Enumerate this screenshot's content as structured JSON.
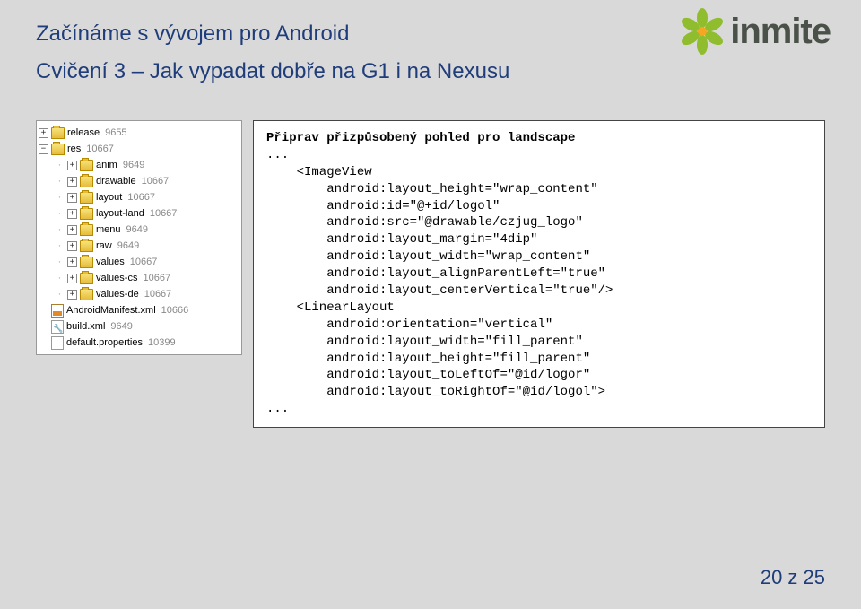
{
  "header": {
    "title": "Začínáme s vývojem pro Android",
    "subtitle": "Cvičení 3 – Jak vypadat dobře na G1 i na Nexusu"
  },
  "logo": {
    "name": "inmite"
  },
  "tree": {
    "items": [
      {
        "level": 0,
        "expander": "+",
        "icon": "folder",
        "label": "release",
        "rev": "9655"
      },
      {
        "level": 0,
        "expander": "-",
        "icon": "folder",
        "label": "res",
        "rev": "10667"
      },
      {
        "level": 1,
        "expander": "+",
        "icon": "folder",
        "label": "anim",
        "rev": "9649"
      },
      {
        "level": 1,
        "expander": "+",
        "icon": "folder",
        "label": "drawable",
        "rev": "10667"
      },
      {
        "level": 1,
        "expander": "+",
        "icon": "folder",
        "label": "layout",
        "rev": "10667"
      },
      {
        "level": 1,
        "expander": "+",
        "icon": "folder",
        "label": "layout-land",
        "rev": "10667"
      },
      {
        "level": 1,
        "expander": "+",
        "icon": "folder",
        "label": "menu",
        "rev": "9649"
      },
      {
        "level": 1,
        "expander": "+",
        "icon": "folder",
        "label": "raw",
        "rev": "9649"
      },
      {
        "level": 1,
        "expander": "+",
        "icon": "folder",
        "label": "values",
        "rev": "10667"
      },
      {
        "level": 1,
        "expander": "+",
        "icon": "folder",
        "label": "values-cs",
        "rev": "10667"
      },
      {
        "level": 1,
        "expander": "+",
        "icon": "folder",
        "label": "values-de",
        "rev": "10667"
      },
      {
        "level": 0,
        "expander": "",
        "icon": "xml",
        "label": "AndroidManifest.xml",
        "rev": "10666"
      },
      {
        "level": 0,
        "expander": "",
        "icon": "wrench",
        "label": "build.xml",
        "rev": "9649"
      },
      {
        "level": 0,
        "expander": "",
        "icon": "file",
        "label": "default.properties",
        "rev": "10399"
      }
    ]
  },
  "code": {
    "title": "Připrav přizpůsobený pohled pro landscape",
    "l1": "...",
    "l2": "    <ImageView",
    "l3": "        android:layout_height=\"wrap_content\"",
    "l4": "        android:id=\"@+id/logol\"",
    "l5": "        android:src=\"@drawable/czjug_logo\"",
    "l6": "        android:layout_margin=\"4dip\"",
    "l7": "        android:layout_width=\"wrap_content\"",
    "l8": "        android:layout_alignParentLeft=\"true\"",
    "l9": "        android:layout_centerVertical=\"true\"/>",
    "l10": "    <LinearLayout",
    "l11": "        android:orientation=\"vertical\"",
    "l12": "        android:layout_width=\"fill_parent\"",
    "l13": "        android:layout_height=\"fill_parent\"",
    "l14": "        android:layout_toLeftOf=\"@id/logor\"",
    "l15": "        android:layout_toRightOf=\"@id/logol\">",
    "l16": "..."
  },
  "footer": {
    "page": "20 z 25"
  }
}
